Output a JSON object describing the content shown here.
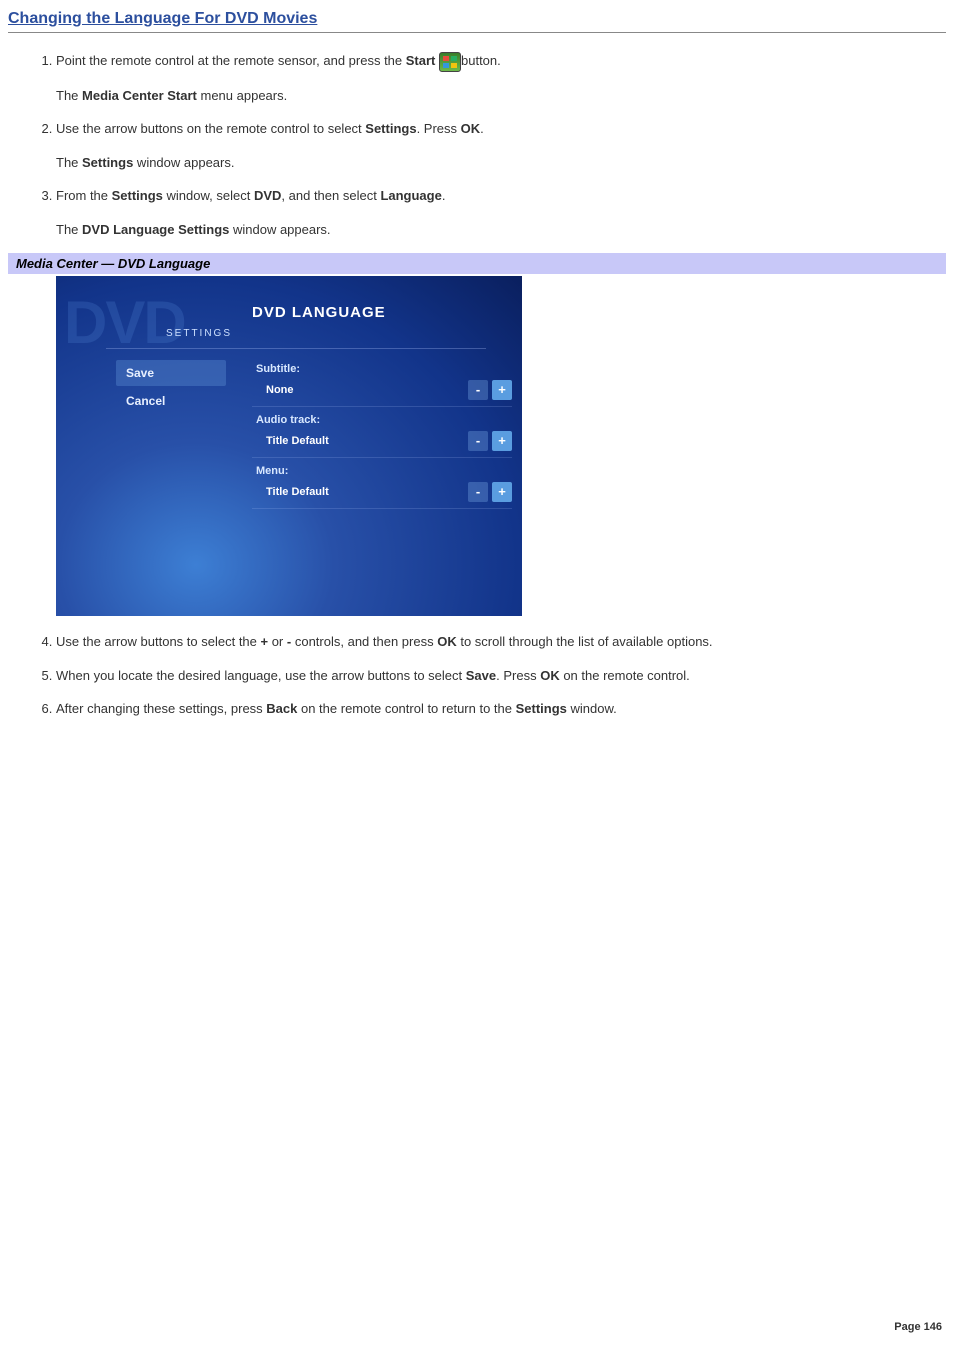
{
  "heading": "Changing the Language For DVD Movies",
  "steps": {
    "s1_a": "Point the remote control at the remote sensor, and press the ",
    "s1_b": "Start",
    "s1_c": "button.",
    "s1_d_a": "The ",
    "s1_d_b": "Media Center Start",
    "s1_d_c": " menu appears.",
    "s2_a": "Use the arrow buttons on the remote control to select ",
    "s2_b": "Settings",
    "s2_c": ". Press ",
    "s2_d": "OK",
    "s2_e": ".",
    "s2_f_a": "The ",
    "s2_f_b": "Settings",
    "s2_f_c": " window appears.",
    "s3_a": "From the ",
    "s3_b": "Settings",
    "s3_c": " window, select ",
    "s3_d": "DVD",
    "s3_e": ", and then select ",
    "s3_f": "Language",
    "s3_g": ".",
    "s3_h_a": "The ",
    "s3_h_b": "DVD Language Settings",
    "s3_h_c": " window appears.",
    "s4_a": "Use the arrow buttons to select the ",
    "s4_b": "+",
    "s4_c": " or ",
    "s4_d": "-",
    "s4_e": " controls, and then press ",
    "s4_f": "OK",
    "s4_g": " to scroll through the list of available options.",
    "s5_a": "When you locate the desired language, use the arrow buttons to select ",
    "s5_b": "Save",
    "s5_c": ". Press ",
    "s5_d": "OK",
    "s5_e": " on the remote control.",
    "s6_a": "After changing these settings, press ",
    "s6_b": "Back",
    "s6_c": " on the remote control to return to the ",
    "s6_d": "Settings",
    "s6_e": " window."
  },
  "caption": "Media Center — DVD Language",
  "mc": {
    "bgword": "DVD",
    "settings_small": "SETTINGS",
    "title": "DVD LANGUAGE",
    "save": "Save",
    "cancel": "Cancel",
    "subtitle_label": "Subtitle:",
    "subtitle_value": "None",
    "audio_label": "Audio track:",
    "audio_value": "Title Default",
    "menu_label": "Menu:",
    "menu_value": "Title Default",
    "minus": "-",
    "plus": "+"
  },
  "pagenum": "Page 146"
}
